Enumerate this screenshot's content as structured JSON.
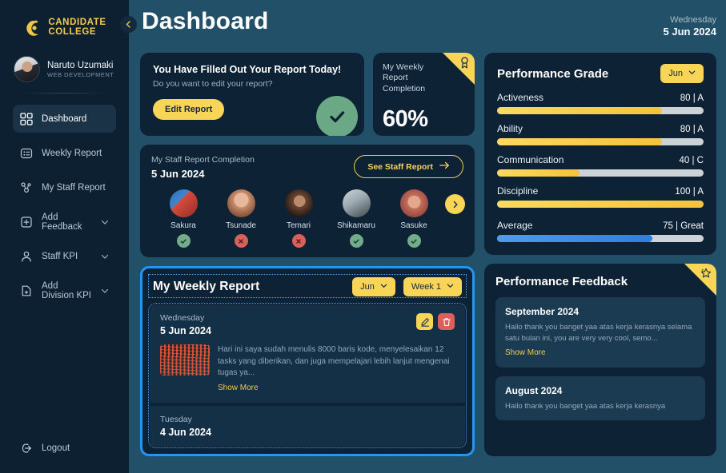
{
  "brand": {
    "line1": "CANDIDATE",
    "line2": "COLLEGE",
    "accent": "#f5cb47"
  },
  "profile": {
    "name": "Naruto Uzumaki",
    "role": "WEB DEVELOPMENT"
  },
  "sidebar": {
    "items": [
      {
        "label": "Dashboard",
        "icon": "grid-icon",
        "active": true,
        "chevron": false
      },
      {
        "label": "Weekly Report",
        "icon": "report-icon",
        "active": false,
        "chevron": false
      },
      {
        "label": "My Staff Report",
        "icon": "people-icon",
        "active": false,
        "chevron": false
      },
      {
        "label": "Add Feedback",
        "icon": "plus-square-icon",
        "active": false,
        "chevron": true
      },
      {
        "label": "Staff KPI",
        "icon": "user-icon",
        "active": false,
        "chevron": true
      },
      {
        "label": "Add Division KPI",
        "icon": "file-plus-icon",
        "active": false,
        "chevron": true
      }
    ],
    "logout_label": "Logout"
  },
  "header": {
    "title": "Dashboard",
    "date_day": "Wednesday",
    "date_full": "5 Jun 2024"
  },
  "filled_report": {
    "title": "You Have Filled Out Your Report Today!",
    "subtitle": "Do you want to edit your report?",
    "button_label": "Edit Report",
    "status_icon": "check-icon",
    "status_color": "#6aa886"
  },
  "completion": {
    "label": "My Weekly Report Completion",
    "value": "60%",
    "badge_icon": "medal-icon",
    "badge_color": "#f8d557"
  },
  "staff_report": {
    "label": "My Staff Report Completion",
    "date": "5 Jun 2024",
    "button_label": "See Staff Report",
    "members": [
      {
        "name": "Sakura",
        "status": "done"
      },
      {
        "name": "Tsunade",
        "status": "missing"
      },
      {
        "name": "Temari",
        "status": "missing"
      },
      {
        "name": "Shikamaru",
        "status": "done"
      },
      {
        "name": "Sasuke",
        "status": "done"
      }
    ]
  },
  "weekly_report": {
    "title": "My Weekly Report",
    "month_select": "Jun",
    "week_select": "Week 1",
    "entries": [
      {
        "day": "Wednesday",
        "date": "5 Jun 2024",
        "text": "Hari ini saya sudah menulis 8000 baris kode, menyelesaikan 12 tasks yang diberikan, dan juga mempelajari lebih lanjut mengenai tugas ya...",
        "show_more": "Show More",
        "edit_icon": "pencil-icon",
        "delete_icon": "trash-icon"
      },
      {
        "day": "Tuesday",
        "date": "4 Jun 2024"
      }
    ]
  },
  "performance_grade": {
    "title": "Performance Grade",
    "month_select": "Jun",
    "metrics": [
      {
        "name": "Activeness",
        "value": "80 | A",
        "percent": 80
      },
      {
        "name": "Ability",
        "value": "80 | A",
        "percent": 80
      },
      {
        "name": "Communication",
        "value": "40 | C",
        "percent": 40
      },
      {
        "name": "Discipline",
        "value": "100 | A",
        "percent": 100
      }
    ],
    "average": {
      "name": "Average",
      "value": "75 | Great",
      "percent": 75
    }
  },
  "performance_feedback": {
    "title": "Performance Feedback",
    "badge_icon": "star-icon",
    "items": [
      {
        "month": "September 2024",
        "text": "Hailo thank you banget yaa atas kerja kerasnya selama satu bulan ini, you are very very cool, semo...",
        "show_more": "Show More"
      },
      {
        "month": "August 2024",
        "text": "Hailo thank you banget yaa atas kerja kerasnya"
      }
    ]
  }
}
